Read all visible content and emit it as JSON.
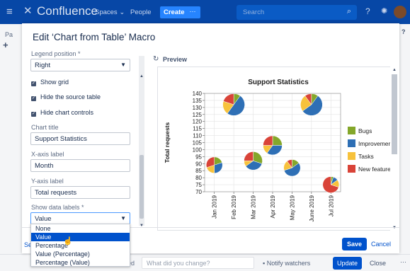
{
  "topnav": {
    "brand": "Confluence",
    "spaces": "Spaces ⌄",
    "people": "People",
    "create": "Create",
    "more": "···",
    "search_placeholder": "Search"
  },
  "background": {
    "left_text": "Pa",
    "question": "?",
    "footer_prefix": "ed",
    "change_placeholder": "What did you change?",
    "notify": "Notify watchers",
    "update": "Update",
    "close": "Close",
    "ellipsis": "···"
  },
  "dialog": {
    "title": "Edit ‘Chart from Table’ Macro",
    "preview_label": "Preview",
    "save": "Save",
    "cancel": "Cancel",
    "footer_link_fragment": "Se"
  },
  "form": {
    "legend_position": {
      "label": "Legend position *",
      "value": "Right"
    },
    "show_grid": {
      "label": "Show grid",
      "checked": true
    },
    "hide_source_table": {
      "label": "Hide the source table",
      "checked": true
    },
    "hide_chart_controls": {
      "label": "Hide chart controls",
      "checked": true
    },
    "chart_title": {
      "label": "Chart title",
      "value": "Support Statistics"
    },
    "x_axis_label": {
      "label": "X-axis label",
      "value": "Month"
    },
    "y_axis_label": {
      "label": "Y-axis label",
      "value": "Total requests"
    },
    "show_data_labels": {
      "label": "Show data labels *",
      "value": "Value",
      "options": [
        "None",
        "Value",
        "Percentage",
        "Value (Percentage)",
        "Percentage (Value)"
      ],
      "selected_index": 1
    }
  },
  "colors": {
    "Bugs": "#84a72a",
    "Improvements": "#2e6fb5",
    "Tasks": "#f7c23c",
    "New features": "#d94338"
  },
  "chart_data": {
    "type": "pie",
    "title": "Support Statistics",
    "ylabel": "Total requests",
    "xlabel": "",
    "ylim": [
      70,
      140
    ],
    "yticks": [
      70,
      75,
      80,
      85,
      90,
      95,
      100,
      105,
      110,
      115,
      120,
      125,
      130,
      135,
      140
    ],
    "legend_position": "right",
    "legend": [
      "Bugs",
      "Improvements",
      "Tasks",
      "New features"
    ],
    "categories": [
      "Jan 2019",
      "Feb 2019",
      "Mar 2019",
      "Apr 2019",
      "May 2019",
      "June 2019",
      "Jul 2019"
    ],
    "points": [
      {
        "x": "Jan 2019",
        "y": 89,
        "size": 0.55,
        "slices": [
          20,
          30,
          20,
          30
        ]
      },
      {
        "x": "Feb 2019",
        "y": 132,
        "size": 0.95,
        "slices": [
          10,
          50,
          20,
          20
        ]
      },
      {
        "x": "Mar 2019",
        "y": 92,
        "size": 0.7,
        "slices": [
          30,
          35,
          10,
          25
        ]
      },
      {
        "x": "Apr 2019",
        "y": 103,
        "size": 0.75,
        "slices": [
          25,
          35,
          15,
          25
        ]
      },
      {
        "x": "May 2019",
        "y": 87,
        "size": 0.58,
        "slices": [
          15,
          55,
          20,
          10
        ]
      },
      {
        "x": "June 2019",
        "y": 132,
        "size": 0.95,
        "slices": [
          10,
          55,
          25,
          10
        ]
      },
      {
        "x": "Jul 2019",
        "y": 75,
        "size": 0.55,
        "slices": [
          5,
          10,
          15,
          70
        ]
      }
    ]
  }
}
